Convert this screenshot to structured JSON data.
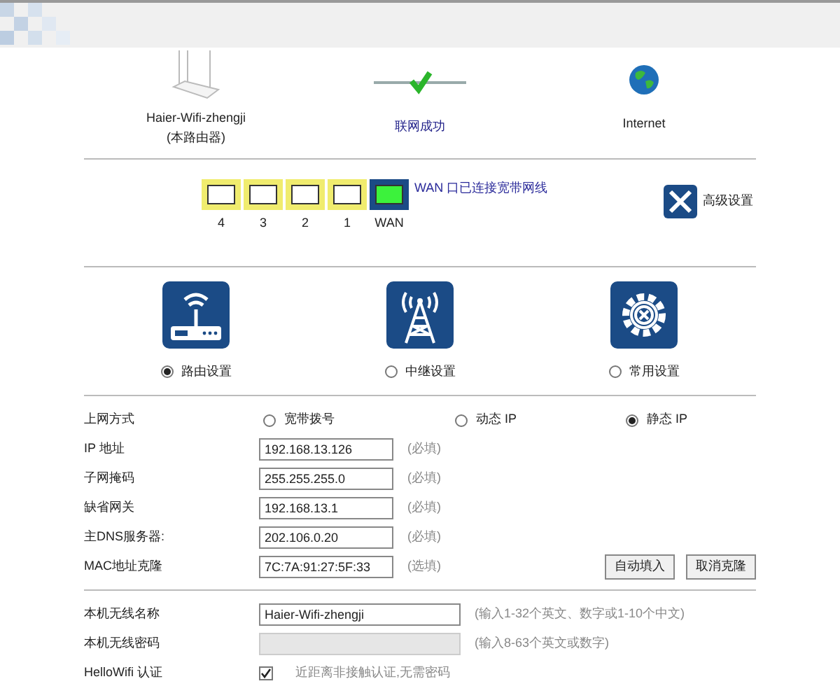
{
  "status": {
    "router_name": "Haier-Wifi-zhengji",
    "router_note": "(本路由器)",
    "connection": "联网成功",
    "internet": "Internet"
  },
  "ports": [
    {
      "label": "4",
      "kind": "lan",
      "connected": false
    },
    {
      "label": "3",
      "kind": "lan",
      "connected": false
    },
    {
      "label": "2",
      "kind": "lan",
      "connected": false
    },
    {
      "label": "1",
      "kind": "lan",
      "connected": false
    },
    {
      "label": "WAN",
      "kind": "wan",
      "connected": true
    }
  ],
  "wan_message": "WAN 口已连接宽带网线",
  "advanced": "高级设置",
  "modes": [
    {
      "label": "路由设置",
      "kind": "router",
      "selected": true
    },
    {
      "label": "中继设置",
      "kind": "repeater",
      "selected": false
    },
    {
      "label": "常用设置",
      "kind": "general",
      "selected": false
    }
  ],
  "connection_type": {
    "label": "上网方式",
    "options": [
      {
        "label": "宽带拨号",
        "selected": false
      },
      {
        "label": "动态 IP",
        "selected": false
      },
      {
        "label": "静态 IP",
        "selected": true
      }
    ]
  },
  "fields": [
    {
      "label": "IP 地址",
      "value": "192.168.13.126",
      "hint": "(必填)"
    },
    {
      "label": "子网掩码",
      "value": "255.255.255.0",
      "hint": "(必填)"
    },
    {
      "label": "缺省网关",
      "value": "192.168.13.1",
      "hint": "(必填)"
    },
    {
      "label": "主DNS服务器:",
      "value": "202.106.0.20",
      "hint": "(必填)"
    },
    {
      "label": "MAC地址克隆",
      "value": "7C:7A:91:27:5F:33",
      "hint": "(选填)"
    }
  ],
  "buttons": [
    "自动填入",
    "取消克隆"
  ],
  "wireless": [
    {
      "label": "本机无线名称",
      "value": "Haier-Wifi-zhengji",
      "hint": "(输入1-32个英文、数字或1-10个中文)",
      "disabled": false
    },
    {
      "label": "本机无线密码",
      "hint": "(输入8-63个英文或数字)",
      "disabled": true
    }
  ],
  "hellowifi": {
    "label": "HelloWifi 认证",
    "checked": true,
    "text": "近距离非接触认证,无需密码"
  }
}
